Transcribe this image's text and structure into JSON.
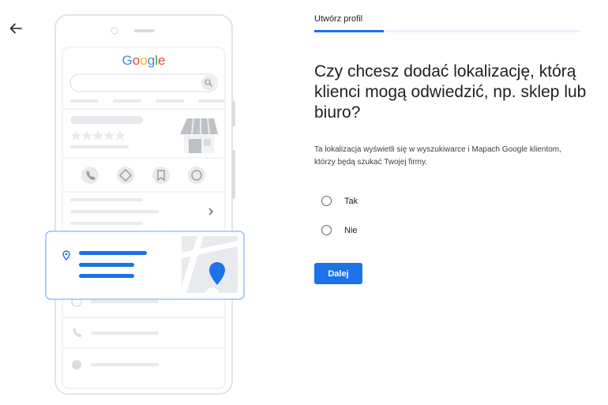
{
  "icons": {
    "back": "arrow-left-icon",
    "pin": "location-pin-icon"
  },
  "colors": {
    "accent": "#1a73e8",
    "progress_track": "#e8f0fe"
  },
  "illustration": {
    "brand": "Google"
  },
  "header": {
    "step_label": "Utwórz profil",
    "progress": 0.26
  },
  "main": {
    "question": "Czy chcesz dodać lokalizację, którą klienci mogą odwiedzić, np. sklep lub biuro?",
    "description": "Ta lokalizacja wyświetli się w wyszukiwarce i Mapach Google klientom, którzy będą szukać Twojej firmy.",
    "options": [
      {
        "label": "Tak",
        "selected": false
      },
      {
        "label": "Nie",
        "selected": false
      }
    ],
    "next_label": "Dalej"
  }
}
